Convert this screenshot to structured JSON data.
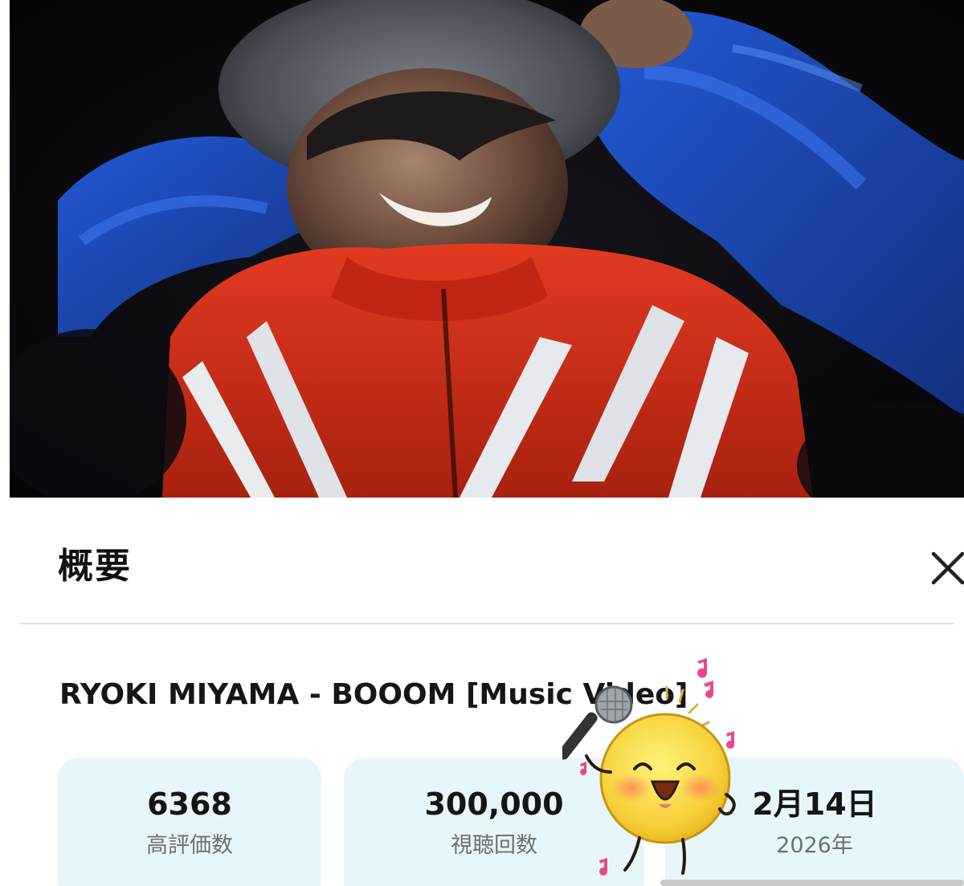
{
  "panel": {
    "title": "概要",
    "close_icon": "close-icon"
  },
  "video": {
    "title": "RYOKI MIYAMA - BOOOM [Music Video]"
  },
  "stats": [
    {
      "value": "6368",
      "label": "高評価数"
    },
    {
      "value": "300,000",
      "label": "視聴回数"
    },
    {
      "value": "2月14日",
      "label": "2026年"
    }
  ],
  "overlay": {
    "sticker": "sun-character-with-microphone-sticker"
  },
  "colors": {
    "card_background": "#e7f6fa",
    "jacket_blue": "#1e4fc8",
    "jacket_red": "#d22a16"
  }
}
